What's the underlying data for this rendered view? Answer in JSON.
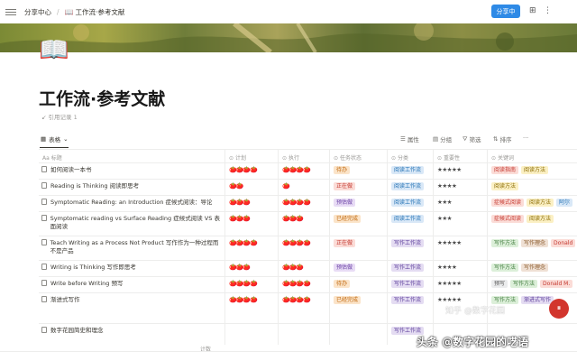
{
  "topbar": {
    "breadcrumb_root": "分享中心",
    "breadcrumb_sep": "/",
    "breadcrumb_page_icon": "📖",
    "breadcrumb_page": "工作流·参考文献",
    "share_label": "分享中",
    "icons": [
      "menu-icon",
      "book-icon",
      "bookmark-icon",
      "more-icon"
    ]
  },
  "page": {
    "icon": "📖",
    "title": "工作流·参考文献",
    "citation": "引用记录 1"
  },
  "viewbar": {
    "view_label": "表格",
    "props": "属性",
    "group": "分组",
    "filter": "筛选",
    "sort": "排序",
    "more": "···"
  },
  "columns": [
    {
      "label": "标题"
    },
    {
      "label": "计划"
    },
    {
      "label": "执行"
    },
    {
      "label": "任务状态"
    },
    {
      "label": "分类"
    },
    {
      "label": "重要性"
    },
    {
      "label": "关键词"
    }
  ],
  "rows": [
    {
      "title": "如何阅读一本书",
      "plan": "🍅🍅🍅🍅",
      "exec": "🍅🍅🍅🍅",
      "status": "待办",
      "status_color": "t-orange",
      "category": "阅读工作流",
      "stars": "★★★★★",
      "keywords": [
        {
          "t": "阅读指南",
          "c": "t-red"
        },
        {
          "t": "阅读方法",
          "c": "t-yellow"
        }
      ]
    },
    {
      "title": "Reading is Thinking 阅读即思考",
      "plan": "🍅🍅",
      "exec": "🍅",
      "status": "正在做",
      "status_color": "t-red",
      "category": "阅读工作流",
      "stars": "★★★★",
      "keywords": [
        {
          "t": "阅读方法",
          "c": "t-yellow"
        }
      ]
    },
    {
      "title": "Symptomatic Reading: an Introduction 症候式阅读：导论",
      "plan": "🍅🍅🍅",
      "exec": "🍅🍅🍅🍅",
      "status": "预估做",
      "status_color": "t-purple",
      "category": "阅读工作流",
      "stars": "★★★",
      "keywords": [
        {
          "t": "症候式阅读",
          "c": "t-red"
        },
        {
          "t": "阅读方法",
          "c": "t-yellow"
        },
        {
          "t": "阿尔",
          "c": "t-blue"
        }
      ]
    },
    {
      "title": "Symptomatic reading vs Surface Reading 症候式阅读 VS 表面阅读",
      "plan": "🍅🍅🍅",
      "exec": "🍅🍅🍅",
      "status": "已经完成",
      "status_color": "t-orange",
      "category": "阅读工作流",
      "stars": "★★★",
      "keywords": [
        {
          "t": "症候式阅读",
          "c": "t-red"
        },
        {
          "t": "阅读方法",
          "c": "t-yellow"
        }
      ]
    },
    {
      "title": "Teach Writing as a Process Not Product 写作作为一种过程而不是产品",
      "plan": "🍅🍅🍅🍅",
      "exec": "🍅🍅🍅🍅",
      "status": "正在做",
      "status_color": "t-red",
      "category": "写作工作流",
      "stars": "★★★★★",
      "keywords": [
        {
          "t": "写作方法",
          "c": "t-green"
        },
        {
          "t": "写作理念",
          "c": "t-brown"
        },
        {
          "t": "Donald",
          "c": "t-red"
        }
      ]
    },
    {
      "title": "Writing is Thinking 写作即思考",
      "plan": "🍅🍅🍅",
      "exec": "🍅🍅🍅",
      "status": "预估做",
      "status_color": "t-purple",
      "category": "写作工作流",
      "stars": "★★★★",
      "keywords": [
        {
          "t": "写作方法",
          "c": "t-green"
        },
        {
          "t": "写作理念",
          "c": "t-brown"
        }
      ]
    },
    {
      "title": "Write before Writing 预写",
      "plan": "🍅🍅🍅🍅",
      "exec": "🍅🍅🍅🍅",
      "status": "待办",
      "status_color": "t-orange",
      "category": "写作工作流",
      "stars": "★★★★★",
      "keywords": [
        {
          "t": "预写",
          "c": "t-gray"
        },
        {
          "t": "写作方法",
          "c": "t-green"
        },
        {
          "t": "Donald M.",
          "c": "t-red"
        }
      ]
    },
    {
      "title": "渐进式写作",
      "plan": "🍅🍅🍅🍅",
      "exec": "🍅🍅🍅🍅",
      "status": "已经完成",
      "status_color": "t-orange",
      "category": "写作工作流",
      "stars": "★★★★★",
      "keywords": [
        {
          "t": "写作方法",
          "c": "t-green"
        },
        {
          "t": "渐进式写作",
          "c": "t-violet"
        }
      ]
    },
    {
      "title": "数字花园简史和理念",
      "plan": "",
      "exec": "",
      "status": "",
      "status_color": "",
      "category": "写作工作流",
      "stars": "",
      "keywords": []
    }
  ],
  "footer_count": "计数",
  "watermark": "头条 @数字花园的呓语",
  "watermark_faint": "知乎 @数字花园",
  "float_button": "⏸"
}
